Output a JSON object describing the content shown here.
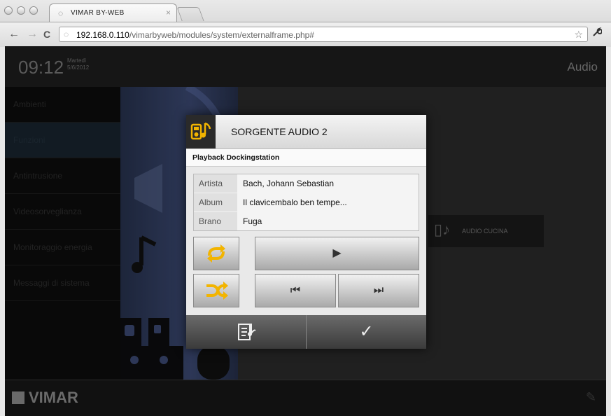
{
  "browser": {
    "tab_title": "VIMAR BY-WEB",
    "tab_close": "×",
    "url_host": "192.168.0.110",
    "url_path": "/vimarbyweb/modules/system/externalframe.php#",
    "icons": {
      "back": "←",
      "forward": "→",
      "reload": "C",
      "star": "☆",
      "wrench": "🔧"
    }
  },
  "app": {
    "time": "09:12",
    "weekday": "Martedì",
    "date": "5/6/2012",
    "section": "Audio",
    "sidebar": [
      {
        "label": "Ambienti"
      },
      {
        "label": "Funzioni"
      },
      {
        "label": "Antintrusione"
      },
      {
        "label": "Videosorveglianza"
      },
      {
        "label": "Monitoraggio energia"
      },
      {
        "label": "Messaggi di sistema"
      }
    ],
    "tile_label": "AUDIO CUCINA",
    "logo": "VIMAR"
  },
  "modal": {
    "title": "SORGENTE AUDIO 2",
    "subtitle": "Playback Dockingstation",
    "info": [
      {
        "key": "Artista",
        "value": "Bach, Johann Sebastian"
      },
      {
        "key": "Album",
        "value": "Il clavicembalo ben tempe..."
      },
      {
        "key": "Brano",
        "value": "Fuga"
      }
    ],
    "icons": {
      "repeat": "repeat-icon",
      "shuffle": "shuffle-icon",
      "play": "▶",
      "previous": "⏮",
      "next": "⏭",
      "playlist": "playlist-icon",
      "confirm": "✓"
    },
    "accent": "#f2b400"
  }
}
